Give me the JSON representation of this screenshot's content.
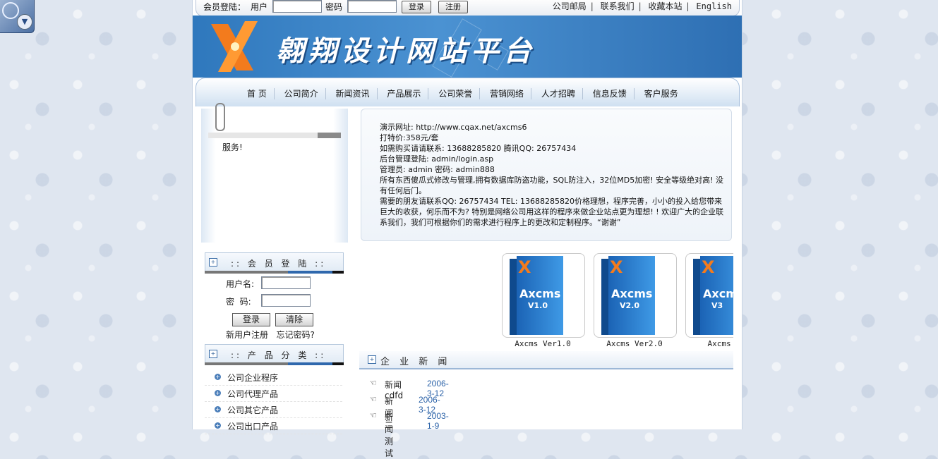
{
  "topbar": {
    "member_login_label": "会员登陆：",
    "user_label": "用户",
    "password_label": "密码",
    "login_button": "登录",
    "register_button": "注册",
    "links": [
      "公司邮局",
      "联系我们",
      "收藏本站",
      "English"
    ]
  },
  "banner": {
    "logo_letter": "X",
    "site_title": "翱翔设计网站平台"
  },
  "nav": {
    "items": [
      "首 页",
      "公司简介",
      "新闻资讯",
      "产品展示",
      "公司荣誉",
      "营销网络",
      "人才招聘",
      "信息反馈",
      "客户服务"
    ]
  },
  "notice": {
    "text": "服务!"
  },
  "info": {
    "lines": [
      "演示网址: http://www.cqax.net/axcms6",
      "打特价:358元/套",
      "如需购买请请联系: 13688285820 腾讯QQ: 26757434",
      "后台管理登陆: admin/login.asp",
      "管理员: admin 密码: admin888",
      "所有东西傻瓜式修改与管理,拥有数据库防盗功能，SQL防注入，32位MD5加密! 安全等级绝对高! 没有任何后门。",
      "需要的朋友请联系QQ: 26757434 TEL: 13688285820价格理想，程序完善，小小的投入给您带来巨大的收获，何乐而不为? 特别是网络公司用这样的程序来做企业站点更为理想! ! 欢迎广大的企业联系我们，我们可根据你们的需求进行程序上的更改和定制程序。“谢谢”"
    ]
  },
  "member_box": {
    "title": ":: 会 员 登 陆 ::",
    "username_label": "用户名:",
    "password_label": "密  码:",
    "login_button": "登录",
    "clear_button": "清除",
    "register_link": "新用户注册",
    "forgot_link": "忘记密码?"
  },
  "category_box": {
    "title": ":: 产 品 分 类 ::",
    "items": [
      "公司企业程序",
      "公司代理产品",
      "公司其它产品",
      "公司出口产品"
    ]
  },
  "products": {
    "items": [
      {
        "name": "Axcms",
        "version": "V1.0",
        "caption": "Axcms Ver1.0"
      },
      {
        "name": "Axcms",
        "version": "V2.0",
        "caption": "Axcms Ver2.0"
      },
      {
        "name": "Axcms",
        "version": "V3",
        "caption": "Axcms Ve"
      }
    ]
  },
  "news": {
    "title": "企 业 新 闻",
    "items": [
      {
        "title": "新闻cdfd",
        "date": "2006-3-12"
      },
      {
        "title": "新闻二",
        "date": "2006-3-12"
      },
      {
        "title": "新闻测试",
        "date": "2003-1-9"
      }
    ]
  },
  "colors": {
    "banner_blue": "#2f78bd",
    "accent_orange": "#f37b1d",
    "link_blue": "#2b62a8"
  }
}
